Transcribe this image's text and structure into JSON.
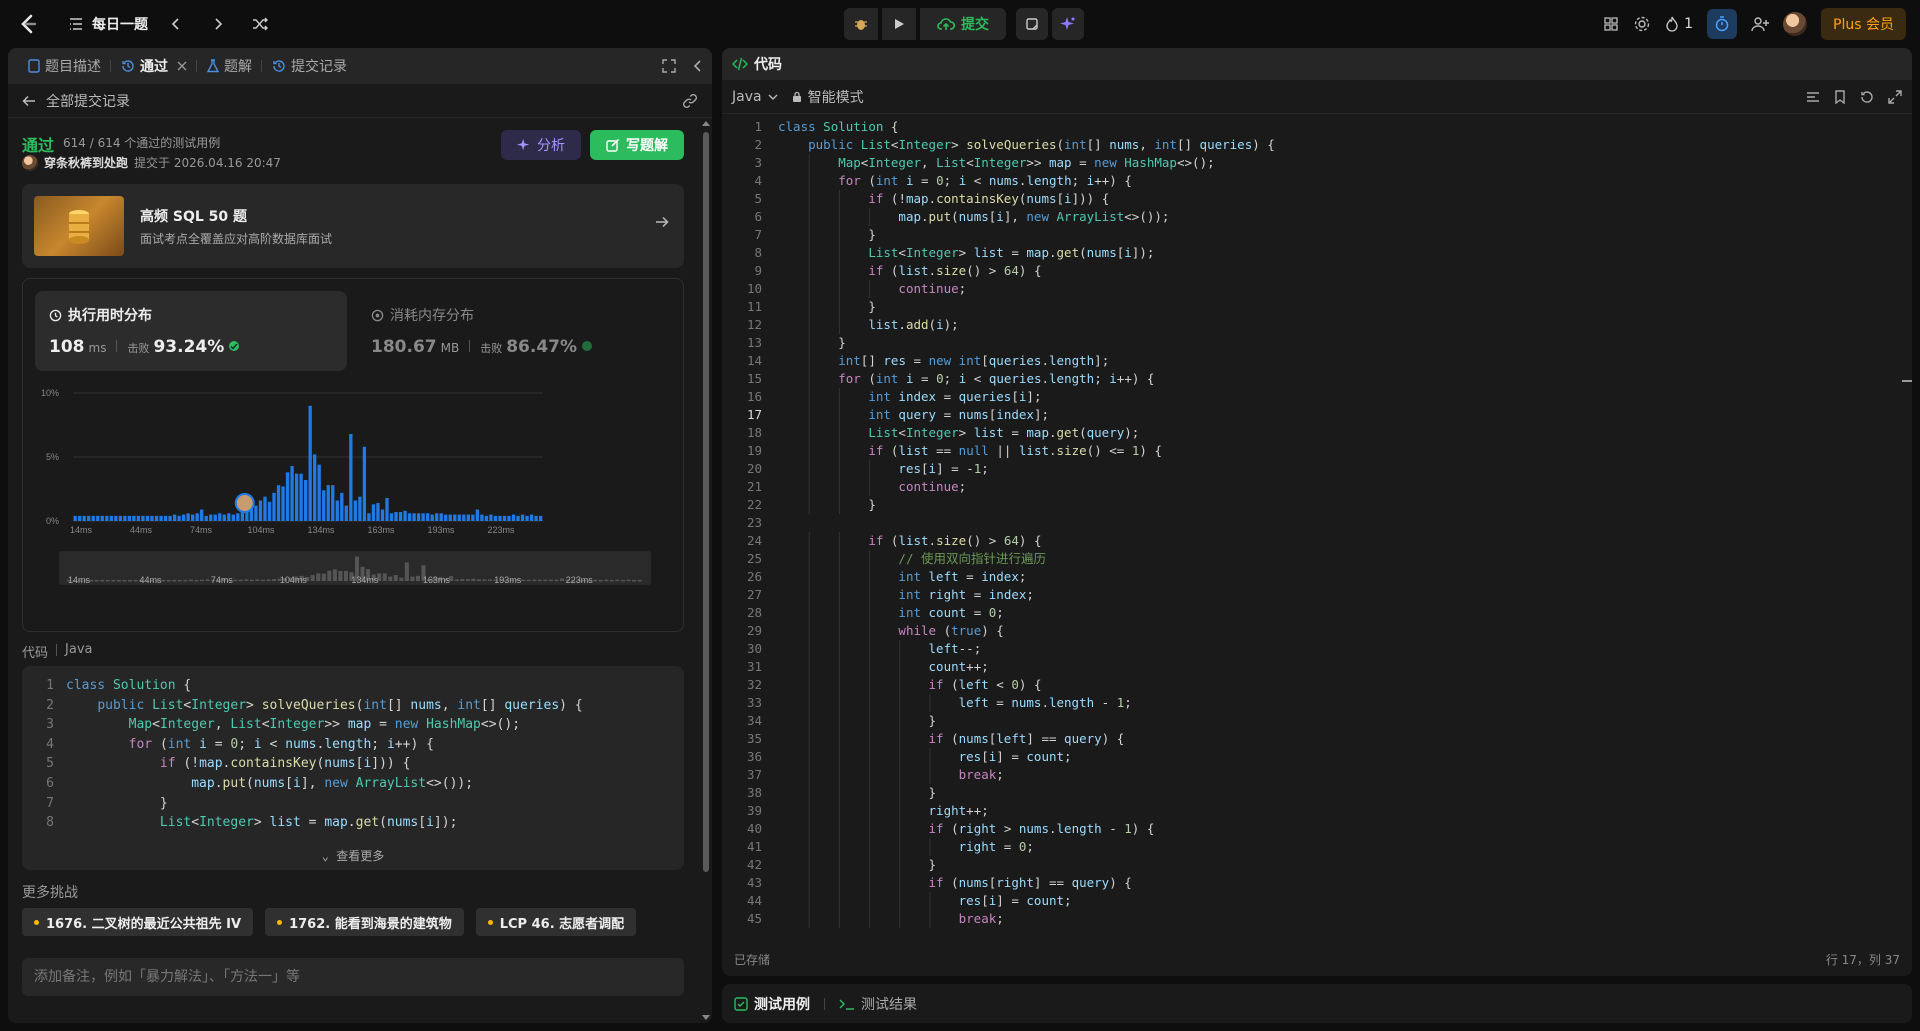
{
  "topbar": {
    "problem_list": "每日一题",
    "submit_label": "提交",
    "streak_count": "1",
    "plus_label": "Plus 会员"
  },
  "left_tabs": [
    {
      "label": "题目描述"
    },
    {
      "label": "通过"
    },
    {
      "label": "题解"
    },
    {
      "label": "提交记录"
    }
  ],
  "back": {
    "label": "全部提交记录"
  },
  "result": {
    "status": "通过",
    "cases": "614 / 614 个通过的测试用例",
    "user": "穿条秋裤到处跑",
    "submitted_at": "提交于 2026.04.16 20:47",
    "analyze_label": "分析",
    "write_label": "写题解"
  },
  "promo": {
    "title": "高频 SQL 50 题",
    "desc": "面试考点全覆盖应对高阶数据库面试"
  },
  "runtime": {
    "label": "执行用时分布",
    "value": "108",
    "unit": "ms",
    "beat_label": "击败",
    "percent": "93.24%"
  },
  "memory": {
    "label": "消耗内存分布",
    "value": "180.67",
    "unit": "MB",
    "beat_label": "击败",
    "percent": "86.47%"
  },
  "chart_data": {
    "type": "bar",
    "title": "",
    "xlabel": "",
    "ylabel": "",
    "ylim": [
      0,
      10
    ],
    "y_ticks": [
      "0%",
      "5%",
      "10%"
    ],
    "x_ticks": [
      "14ms",
      "44ms",
      "74ms",
      "104ms",
      "134ms",
      "163ms",
      "193ms",
      "223ms"
    ],
    "overview_ticks": [
      "14ms",
      "44ms",
      "74ms",
      "104ms",
      "134ms",
      "163ms",
      "193ms",
      "223ms"
    ],
    "grid": true,
    "highlight_value_ms": 108,
    "values": [
      0.4,
      0.4,
      0.4,
      0.4,
      0.4,
      0.4,
      0.4,
      0.4,
      0.4,
      0.4,
      0.4,
      0.4,
      0.4,
      0.4,
      0.4,
      0.4,
      0.4,
      0.4,
      0.4,
      0.4,
      0.4,
      0.4,
      0.5,
      0.4,
      0.5,
      0.6,
      0.5,
      0.6,
      0.9,
      0.4,
      0.5,
      0.5,
      0.6,
      0.5,
      0.6,
      0.5,
      0.6,
      0.7,
      0.8,
      1.1,
      1.2,
      1.6,
      1.9,
      1.5,
      2.2,
      2.8,
      2.7,
      3.8,
      4.3,
      3.7,
      3.7,
      3.2,
      9.0,
      5.2,
      4.4,
      2.4,
      2.8,
      2.8,
      1.6,
      2.2,
      1.2,
      6.8,
      1.6,
      1.9,
      5.8,
      0.6,
      1.3,
      1.4,
      0.9,
      1.8,
      0.6,
      0.7,
      0.7,
      0.8,
      0.6,
      0.6,
      0.6,
      0.6,
      0.6,
      0.5,
      0.6,
      0.6,
      0.5,
      0.5,
      0.5,
      0.5,
      0.5,
      0.5,
      0.5,
      0.9,
      0.5,
      0.4,
      0.5,
      0.4,
      0.4,
      0.4,
      0.4,
      0.5,
      0.4,
      0.5,
      0.4,
      0.5,
      0.4,
      0.4
    ]
  },
  "code_section": {
    "label": "代码",
    "lang": "Java",
    "more_label": "查看更多",
    "lines": [
      "class Solution {",
      "    public List<Integer> solveQueries(int[] nums, int[] queries) {",
      "        Map<Integer, List<Integer>> map = new HashMap<>();",
      "        for (int i = 0; i < nums.length; i++) {",
      "            if (!map.containsKey(nums[i])) {",
      "                map.put(nums[i], new ArrayList<>());",
      "            }",
      "            List<Integer> list = map.get(nums[i]);"
    ]
  },
  "challenges": {
    "title": "更多挑战",
    "items": [
      "1676. 二叉树的最近公共祖先 IV",
      "1762. 能看到海景的建筑物",
      "LCP 46. 志愿者调配"
    ]
  },
  "note": {
    "placeholder": "添加备注，例如「暴力解法」、「方法一」等"
  },
  "editor": {
    "tab_label": "代码",
    "language": "Java",
    "mode": "智能模式",
    "saved": "已存储",
    "cursor": "行 17，列 37",
    "current_line": 17,
    "lines": [
      "class Solution {",
      "    public List<Integer> solveQueries(int[] nums, int[] queries) {",
      "        Map<Integer, List<Integer>> map = new HashMap<>();",
      "        for (int i = 0; i < nums.length; i++) {",
      "            if (!map.containsKey(nums[i])) {",
      "                map.put(nums[i], new ArrayList<>());",
      "            }",
      "            List<Integer> list = map.get(nums[i]);",
      "            if (list.size() > 64) {",
      "                continue;",
      "            }",
      "            list.add(i);",
      "        }",
      "        int[] res = new int[queries.length];",
      "        for (int i = 0; i < queries.length; i++) {",
      "            int index = queries[i];",
      "            int query = nums[index];",
      "            List<Integer> list = map.get(query);",
      "            if (list == null || list.size() <= 1) {",
      "                res[i] = -1;",
      "                continue;",
      "            }",
      "",
      "            if (list.size() > 64) {",
      "                // 使用双向指针进行遍历",
      "                int left = index;",
      "                int right = index;",
      "                int count = 0;",
      "                while (true) {",
      "                    left--;",
      "                    count++;",
      "                    if (left < 0) {",
      "                        left = nums.length - 1;",
      "                    }",
      "                    if (nums[left] == query) {",
      "                        res[i] = count;",
      "                        break;",
      "                    }",
      "                    right++;",
      "                    if (right > nums.length - 1) {",
      "                        right = 0;",
      "                    }",
      "                    if (nums[right] == query) {",
      "                        res[i] = count;",
      "                        break;"
    ]
  },
  "bottom_tabs": [
    {
      "label": "测试用例"
    },
    {
      "label": "测试结果"
    }
  ],
  "colors": {
    "accent_green": "#2cbb5d",
    "bar_blue": "#1f7ae6",
    "plus_orange": "#ffa116"
  }
}
